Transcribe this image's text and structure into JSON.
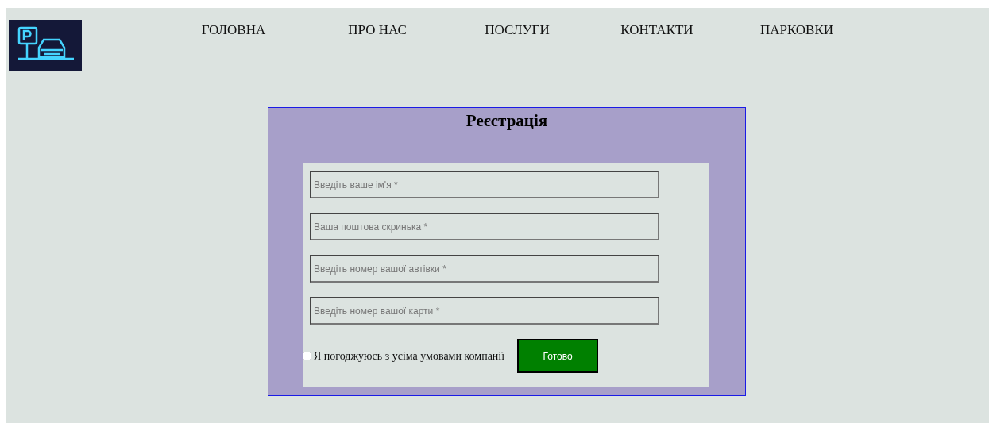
{
  "nav": [
    {
      "label": "ГОЛОВНА"
    },
    {
      "label": "ПРО НАС"
    },
    {
      "label": "ПОСЛУГИ"
    },
    {
      "label": "КОНТАКТИ"
    },
    {
      "label": "ПАРКОВКИ"
    }
  ],
  "form": {
    "title": "Реєстрація",
    "fields": [
      {
        "placeholder": "Введіть ваше ім'я *"
      },
      {
        "placeholder": "Ваша поштова скринька *"
      },
      {
        "placeholder": "Введіть номер вашої автівки *"
      },
      {
        "placeholder": "Введіть номер вашої карти *"
      }
    ],
    "agree": {
      "label": "Я погоджуюсь з усіма умовами компанії",
      "checked": false
    },
    "submit": "Готово"
  }
}
